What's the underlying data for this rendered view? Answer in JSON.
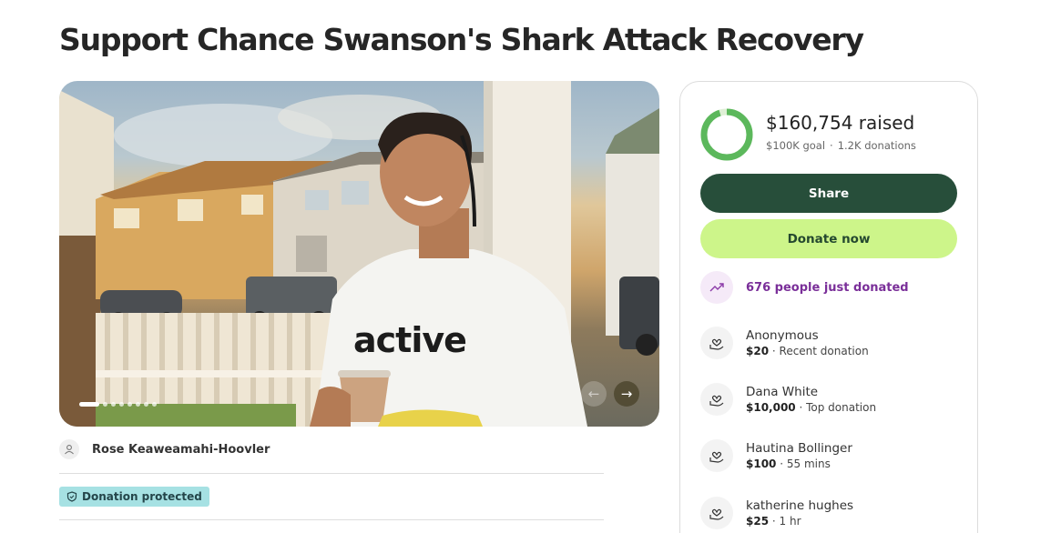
{
  "campaign": {
    "title": "Support Chance Swanson's Shark Attack Recovery",
    "organizer": "Rose Keaweamahi-Hoovler",
    "badge": "Donation protected",
    "photo": {
      "shirt_text": "active",
      "slide_count": 8,
      "active_slide": 1
    }
  },
  "summary": {
    "raised": "$160,754 raised",
    "goal": "$100K goal",
    "donations": "1.2K donations",
    "progress_fraction": 0.95,
    "colors": {
      "ring": "#5cb85c",
      "ring_track": "#dff0d6"
    }
  },
  "actions": {
    "share_label": "Share",
    "donate_label": "Donate now",
    "colors": {
      "share_bg": "#274e3a",
      "donate_bg": "#cdf58a"
    }
  },
  "recent": {
    "just_donated": "676 people just donated",
    "donors": [
      {
        "name": "Anonymous",
        "amount": "$20",
        "note": "Recent donation"
      },
      {
        "name": "Dana White",
        "amount": "$10,000",
        "note": "Top donation"
      },
      {
        "name": "Hautina Bollinger",
        "amount": "$100",
        "note": "55 mins"
      },
      {
        "name": "katherine hughes",
        "amount": "$25",
        "note": "1 hr"
      }
    ]
  }
}
